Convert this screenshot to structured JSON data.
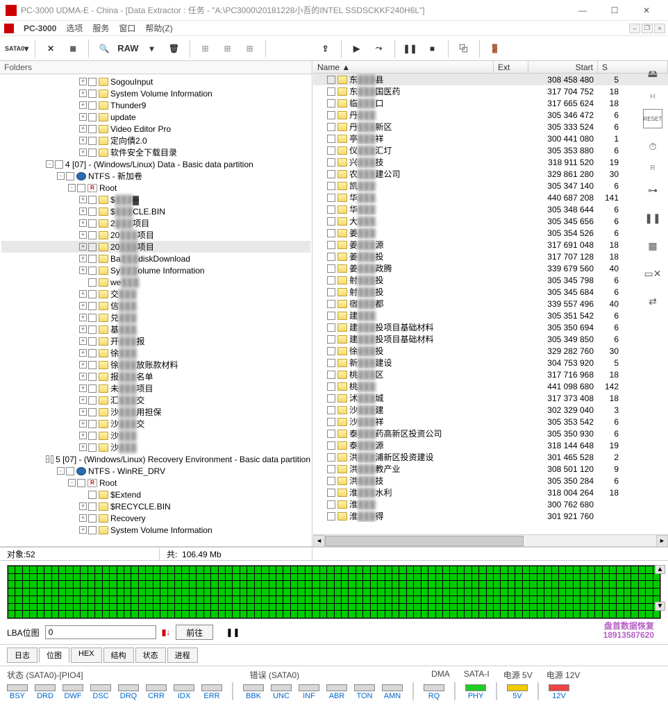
{
  "window": {
    "title": "PC-3000 UDMA-E - China - [Data Extractor : 任务 - \"A:\\PC3000\\20181228小吾的INTEL SSDSCKKF240H6L\"]"
  },
  "menu": {
    "brand": "PC-3000",
    "items": [
      "选项",
      "服务",
      "窗口",
      "帮助(Z)"
    ]
  },
  "toolbar": {
    "sata": "SATA0",
    "raw": "RAW"
  },
  "folders_label": "Folders",
  "tree": [
    {
      "d": 7,
      "t": "+",
      "i": "f",
      "l": "SogouInput"
    },
    {
      "d": 7,
      "t": "+",
      "i": "f",
      "l": "System Volume Information"
    },
    {
      "d": 7,
      "t": "+",
      "i": "f",
      "l": "Thunder9"
    },
    {
      "d": 7,
      "t": "+",
      "i": "f",
      "l": "update"
    },
    {
      "d": 7,
      "t": "+",
      "i": "f",
      "l": "Video Editor Pro"
    },
    {
      "d": 7,
      "t": "+",
      "i": "f",
      "l": "定向債2.0"
    },
    {
      "d": 7,
      "t": "+",
      "i": "f",
      "l": "软件安全下载目录"
    },
    {
      "d": 4,
      "t": "-",
      "i": "",
      "l": "4 [07] - (Windows/Linux) Data - Basic data partition"
    },
    {
      "d": 5,
      "t": "-",
      "i": "b",
      "l": "NTFS - 新加卷"
    },
    {
      "d": 6,
      "t": "-",
      "i": "r",
      "l": "Root"
    },
    {
      "d": 7,
      "t": "+",
      "i": "f",
      "l": "$▓▓▓▓",
      "blur": true
    },
    {
      "d": 7,
      "t": "+",
      "i": "f",
      "l": "$▓▓▓CLE.BIN",
      "blur": true
    },
    {
      "d": 7,
      "t": "+",
      "i": "f",
      "l": "2▓▓▓项目",
      "blur": true
    },
    {
      "d": 7,
      "t": "+",
      "i": "f",
      "l": "20▓▓▓项目",
      "blur": true
    },
    {
      "d": 7,
      "t": "+",
      "i": "f",
      "l": "20▓▓▓项目",
      "blur": true,
      "hl": true
    },
    {
      "d": 7,
      "t": "+",
      "i": "f",
      "l": "Ba▓▓▓diskDownload",
      "blur": true
    },
    {
      "d": 7,
      "t": "+",
      "i": "f",
      "l": "Sy▓▓▓olume Information",
      "blur": true
    },
    {
      "d": 7,
      "t": " ",
      "i": "f",
      "l": "we▓▓▓",
      "blur": true
    },
    {
      "d": 7,
      "t": "+",
      "i": "f",
      "l": "交▓▓▓",
      "blur": true
    },
    {
      "d": 7,
      "t": "+",
      "i": "f",
      "l": "信▓▓▓",
      "blur": true
    },
    {
      "d": 7,
      "t": "+",
      "i": "f",
      "l": "兑▓▓▓",
      "blur": true
    },
    {
      "d": 7,
      "t": "+",
      "i": "f",
      "l": "基▓▓▓",
      "blur": true
    },
    {
      "d": 7,
      "t": "+",
      "i": "f",
      "l": "开▓▓▓报",
      "blur": true
    },
    {
      "d": 7,
      "t": "+",
      "i": "f",
      "l": "徐▓▓▓",
      "blur": true
    },
    {
      "d": 7,
      "t": "+",
      "i": "f",
      "l": "徐▓▓▓放账款材料",
      "blur": true
    },
    {
      "d": 7,
      "t": "+",
      "i": "f",
      "l": "报▓▓▓名单",
      "blur": true
    },
    {
      "d": 7,
      "t": "+",
      "i": "f",
      "l": "未▓▓▓项目",
      "blur": true
    },
    {
      "d": 7,
      "t": "+",
      "i": "f",
      "l": "汇▓▓▓交",
      "blur": true
    },
    {
      "d": 7,
      "t": "+",
      "i": "f",
      "l": "沙▓▓▓用担保",
      "blur": true
    },
    {
      "d": 7,
      "t": "+",
      "i": "f",
      "l": "沙▓▓▓交",
      "blur": true
    },
    {
      "d": 7,
      "t": "+",
      "i": "f",
      "l": "沙▓▓▓",
      "blur": true
    },
    {
      "d": 7,
      "t": "+",
      "i": "f",
      "l": "沙▓▓▓",
      "blur": true
    },
    {
      "d": 4,
      "t": "-",
      "i": "",
      "l": "5 [07] - (Windows/Linux) Recovery Environment - Basic data partition"
    },
    {
      "d": 5,
      "t": "-",
      "i": "b",
      "l": "NTFS - WinRE_DRV"
    },
    {
      "d": 6,
      "t": "-",
      "i": "r",
      "l": "Root"
    },
    {
      "d": 7,
      "t": " ",
      "i": "f",
      "l": "$Extend"
    },
    {
      "d": 7,
      "t": "+",
      "i": "f",
      "l": "$RECYCLE.BIN"
    },
    {
      "d": 7,
      "t": "+",
      "i": "f",
      "l": "Recovery"
    },
    {
      "d": 7,
      "t": "+",
      "i": "f",
      "l": "System Volume Information"
    }
  ],
  "grid": {
    "cols": {
      "name": "Name",
      "ext": "Ext",
      "start": "Start",
      "s": "S"
    },
    "rows": [
      {
        "n": "东▓▓▓县",
        "s": "308 458 480",
        "l": "5",
        "sel": true
      },
      {
        "n": "东▓▓▓国医药",
        "s": "317 704 752",
        "l": "18"
      },
      {
        "n": "临▓▓▓口",
        "s": "317 665 624",
        "l": "18"
      },
      {
        "n": "丹▓▓▓",
        "s": "305 346 472",
        "l": "6"
      },
      {
        "n": "丹▓▓▓新区",
        "s": "305 333 524",
        "l": "6"
      },
      {
        "n": "亭▓▓▓祥",
        "s": "300 441 080",
        "l": "1"
      },
      {
        "n": "仪▓▓▓汇圢",
        "s": "305 353 880",
        "l": "6"
      },
      {
        "n": "兴▓▓▓技",
        "s": "318 911 520",
        "l": "19"
      },
      {
        "n": "农▓▓▓建公司",
        "s": "329 861 280",
        "l": "30"
      },
      {
        "n": "凯▓▓▓",
        "s": "305 347 140",
        "l": "6"
      },
      {
        "n": "华▓▓▓",
        "s": "440 687 208",
        "l": "141"
      },
      {
        "n": "华▓▓▓",
        "s": "305 348 644",
        "l": "6"
      },
      {
        "n": "大▓▓▓",
        "s": "305 345 656",
        "l": "6"
      },
      {
        "n": "姜▓▓▓",
        "s": "305 354 526",
        "l": "6"
      },
      {
        "n": "姜▓▓▓源",
        "s": "317 691 048",
        "l": "18"
      },
      {
        "n": "姜▓▓▓投",
        "s": "317 707 128",
        "l": "18"
      },
      {
        "n": "姜▓▓▓政腾",
        "s": "339 679 560",
        "l": "40"
      },
      {
        "n": "射▓▓▓投",
        "s": "305 345 798",
        "l": "6"
      },
      {
        "n": "射▓▓▓投",
        "s": "305 345 684",
        "l": "6"
      },
      {
        "n": "宿▓▓▓都",
        "s": "339 557 496",
        "l": "40"
      },
      {
        "n": "建▓▓▓",
        "s": "305 351 542",
        "l": "6"
      },
      {
        "n": "建▓▓▓投项目基础材料",
        "s": "305 350 694",
        "l": "6"
      },
      {
        "n": "建▓▓▓投项目基础材料",
        "s": "305 349 850",
        "l": "6"
      },
      {
        "n": "徐▓▓▓投",
        "s": "329 282 760",
        "l": "30"
      },
      {
        "n": "新▓▓▓建设",
        "s": "304 753 920",
        "l": "5"
      },
      {
        "n": "桃▓▓▓区",
        "s": "317 716 968",
        "l": "18"
      },
      {
        "n": "桃▓▓▓",
        "s": "441 098 680",
        "l": "142"
      },
      {
        "n": "沭▓▓▓城",
        "s": "317 373 408",
        "l": "18"
      },
      {
        "n": "沙▓▓▓建",
        "s": "302 329 040",
        "l": "3"
      },
      {
        "n": "沙▓▓▓祥",
        "s": "305 353 542",
        "l": "6"
      },
      {
        "n": "泰▓▓▓药高新区投资公司",
        "s": "305 350 930",
        "l": "6"
      },
      {
        "n": "泰▓▓▓源",
        "s": "318 144 648",
        "l": "19"
      },
      {
        "n": "洪▓▓▓浦新区投资建设",
        "s": "301 465 528",
        "l": "2"
      },
      {
        "n": "洪▓▓▓教产业",
        "s": "308 501 120",
        "l": "9"
      },
      {
        "n": "洪▓▓▓技",
        "s": "305 350 284",
        "l": "6"
      },
      {
        "n": "淮▓▓▓水利",
        "s": "318 004 264",
        "l": "18"
      },
      {
        "n": "淮▓▓▓",
        "s": "300 762 680",
        "l": ""
      },
      {
        "n": "淮▓▓▓得",
        "s": "301 921 760",
        "l": ""
      }
    ]
  },
  "status1": {
    "objects_label": "对象:",
    "objects": "52",
    "total_label": "共:",
    "total": "106.49 Mb"
  },
  "lba": {
    "label": "LBA位图",
    "value": "0",
    "go": "前往"
  },
  "watermark": {
    "l1": "盘首数据恢复",
    "l2": "18913587620"
  },
  "tabs": [
    "日志",
    "位图",
    "HEX",
    "结构",
    "状态",
    "进程"
  ],
  "bottom": {
    "status_label": "状态 (SATA0)-[PIO4]",
    "err_label": "错误 (SATA0)",
    "dma": "DMA",
    "satai": "SATA-I",
    "p5": "电源 5V",
    "p12": "电源 12V",
    "leds_left": [
      "BSY",
      "DRD",
      "DWF",
      "DSC",
      "DRQ",
      "CRR",
      "IDX",
      "ERR"
    ],
    "leds_mid": [
      "BBK",
      "UNC",
      "INF",
      "ABR",
      "TON",
      "AMN"
    ],
    "leds_r": [
      "RQ",
      "PHY",
      "5V",
      "12V"
    ]
  }
}
